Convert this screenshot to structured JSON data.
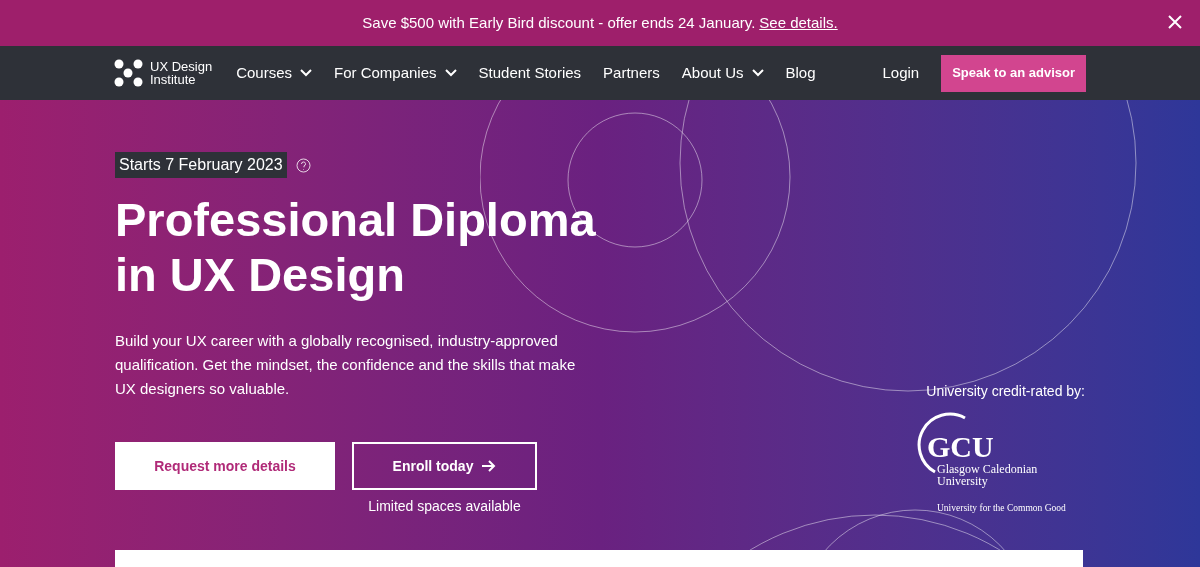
{
  "banner": {
    "text": "Save $500 with Early Bird discount - offer ends 24 January.",
    "link": "See details."
  },
  "nav": {
    "logo_lines": [
      "UX Design",
      "Institute"
    ],
    "items": [
      {
        "label": "Courses",
        "has_menu": true
      },
      {
        "label": "For Companies",
        "has_menu": true
      },
      {
        "label": "Student Stories",
        "has_menu": false
      },
      {
        "label": "Partners",
        "has_menu": false
      },
      {
        "label": "About Us",
        "has_menu": true
      },
      {
        "label": "Blog",
        "has_menu": false
      }
    ],
    "login": "Login",
    "cta": "Speak to an advisor"
  },
  "hero": {
    "start_date": "Starts 7 February 2023",
    "title_lines": [
      "Professional Diploma",
      "in UX Design"
    ],
    "description": "Build your UX career with a globally recognised, industry-approved qualification. Get the mindset, the confidence and the skills that make UX designers so valuable.",
    "primary_button": "Request more details",
    "secondary_button": "Enroll today",
    "note": "Limited spaces available",
    "credit_label": "University credit-rated by:",
    "university": {
      "acronym": "GCU",
      "name_lines": [
        "Glasgow Caledonian",
        "University"
      ],
      "motto": "University for the Common Good"
    }
  }
}
